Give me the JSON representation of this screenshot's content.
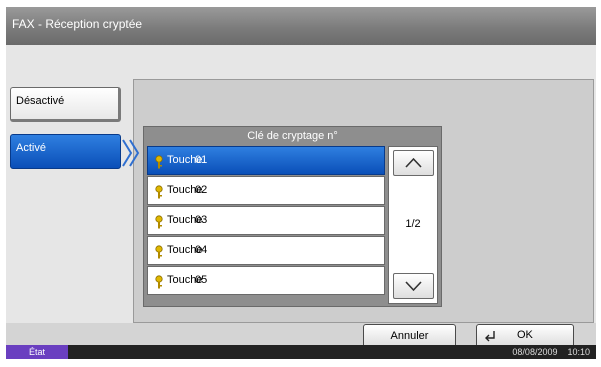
{
  "window": {
    "title": "FAX - Réception cryptée"
  },
  "options": {
    "off_label": "Désactivé",
    "on_label": "Activé"
  },
  "list": {
    "header": "Clé de cryptage n°",
    "rows": [
      {
        "label": "Touche",
        "number": "01"
      },
      {
        "label": "Touche",
        "number": "02"
      },
      {
        "label": "Touche",
        "number": "03"
      },
      {
        "label": "Touche",
        "number": "04"
      },
      {
        "label": "Touche",
        "number": "05"
      }
    ],
    "page_indicator": "1/2"
  },
  "buttons": {
    "cancel": "Annuler",
    "ok": "OK"
  },
  "status": {
    "state": "État",
    "date": "08/08/2009",
    "time": "10:10"
  },
  "colors": {
    "selected": "#0a4fb8",
    "key_icon": "#c8a000",
    "status_badge": "#6a3fc0"
  }
}
